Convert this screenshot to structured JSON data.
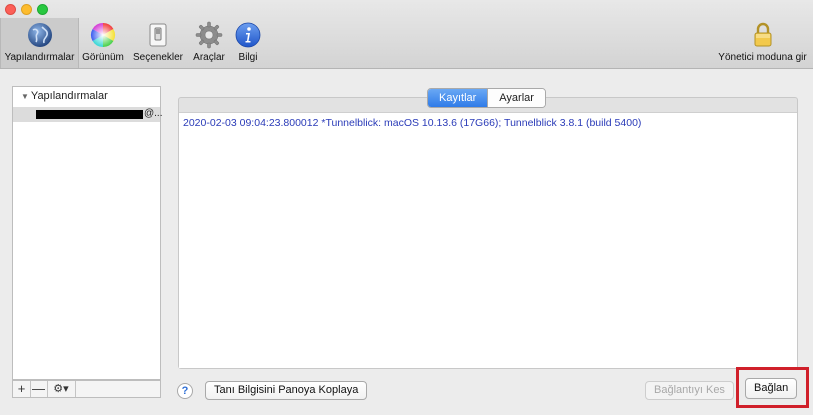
{
  "toolbar": {
    "items": [
      {
        "label": "Yapılandırmalar",
        "icon": "globe-icon"
      },
      {
        "label": "Görünüm",
        "icon": "color-wheel-icon"
      },
      {
        "label": "Seçenekler",
        "icon": "switch-icon"
      },
      {
        "label": "Araçlar",
        "icon": "gear-icon"
      },
      {
        "label": "Bilgi",
        "icon": "info-icon"
      }
    ],
    "admin": {
      "label": "Yönetici moduna gir",
      "icon": "lock-icon"
    }
  },
  "sidebar": {
    "header": "Yapılandırmalar",
    "selected_item_suffix": "@...",
    "buttons": {
      "add": "+",
      "remove": "—",
      "gear_menu": "⚙▾"
    }
  },
  "tabs": [
    "Kayıtlar",
    "Ayarlar"
  ],
  "log": {
    "lines": [
      "2020-02-03 09:04:23.800012 *Tunnelblick: macOS 10.13.6 (17G66); Tunnelblick 3.8.1 (build 5400)"
    ]
  },
  "bottom": {
    "help": "?",
    "copy_diagnostics": "Tanı Bilgisini Panoya Koplaya",
    "disconnect": "Bağlantıyı Kes",
    "connect": "Bağlan"
  },
  "colors": {
    "tab_active": "#3b82ec",
    "log_text": "#2a3bb8",
    "highlight": "#d0202a"
  }
}
